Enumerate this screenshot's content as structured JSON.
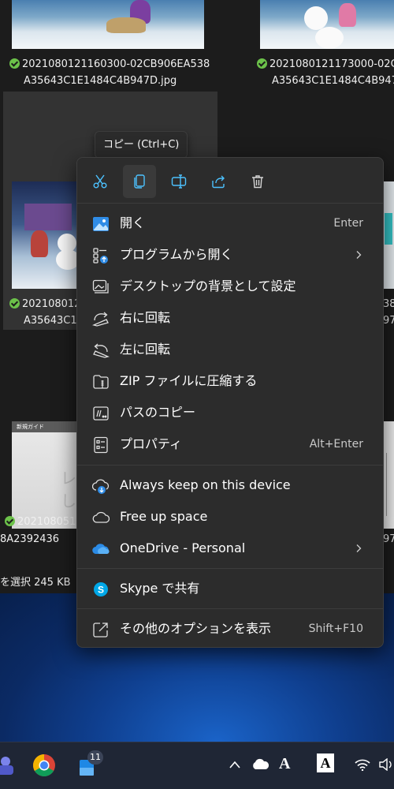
{
  "explorer": {
    "files": [
      {
        "line1": "202108012116030​0-02CB906EA538",
        "line2": "A35643C1E1484C4B947D.jpg"
      },
      {
        "line1": "20210801211730​00-02C",
        "line2": "A35643C1E1484C4B947"
      },
      {
        "line1": "202108012",
        "line2": "A35643C1"
      },
      {
        "line1": "38",
        "line2": "97."
      },
      {
        "line1": "202108051",
        "line2": "8A2392436"
      },
      {
        "line1": "38",
        "line2": "97."
      }
    ],
    "status_text": "を選択  245 KB",
    "doc_thumb_header": "新規ガイド",
    "doc_thumb_text": "レし"
  },
  "tooltip": {
    "text": "コピー (Ctrl+C)"
  },
  "context_menu": {
    "quick_actions": [
      {
        "name": "cut",
        "icon": "scissors-icon"
      },
      {
        "name": "copy",
        "icon": "copy-icon"
      },
      {
        "name": "rename",
        "icon": "rename-icon"
      },
      {
        "name": "share",
        "icon": "share-icon"
      },
      {
        "name": "delete",
        "icon": "trash-icon"
      }
    ],
    "items": [
      {
        "label": "開く",
        "shortcut": "Enter"
      },
      {
        "label": "プログラムから開く",
        "submenu": true
      },
      {
        "label": "デスクトップの背景として設定"
      },
      {
        "label": "右に回転"
      },
      {
        "label": "左に回転"
      },
      {
        "label": "ZIP ファイルに圧縮する"
      },
      {
        "label": "パスのコピー"
      },
      {
        "label": "プロパティ",
        "shortcut": "Alt+Enter"
      },
      {
        "label": "Always keep on this device"
      },
      {
        "label": "Free up space"
      },
      {
        "label": "OneDrive - Personal",
        "submenu": true
      },
      {
        "label": "Skype で共有"
      },
      {
        "label": "その他のオプションを表示",
        "shortcut": "Shift+F10"
      }
    ]
  },
  "taskbar": {
    "mail_badge": "11",
    "tray_font_label": "A"
  },
  "colors": {
    "menu_bg": "#2c2c2c",
    "accent_blue": "#4cc2ff",
    "sync_green": "#6cc24a"
  }
}
